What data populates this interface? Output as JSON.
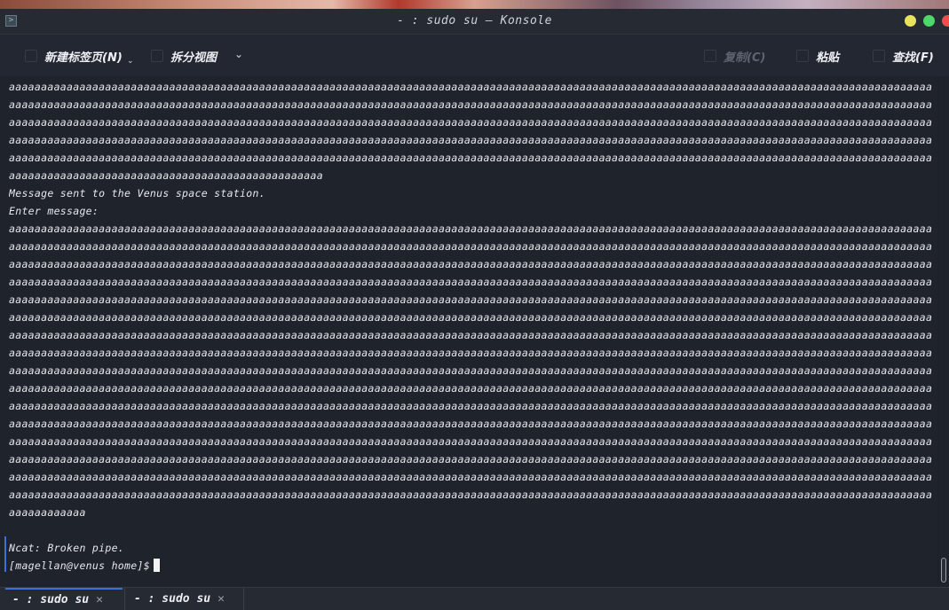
{
  "window": {
    "title": "- : sudo su — Konsole",
    "app_icon": "terminal-app-icon"
  },
  "toolbar": {
    "new_tab_label": "新建标签页(N)",
    "split_view_label": "拆分视图",
    "copy_label": "复制(C)",
    "paste_label": "粘贴",
    "find_label": "查找(F)"
  },
  "terminal": {
    "lines": [
      "aaaaaaaaaaaaaaaaaaaaaaaaaaaaaaaaaaaaaaaaaaaaaaaaaaaaaaaaaaaaaaaaaaaaaaaaaaaaaaaaaaaaaaaaaaaaaaaaaaaaaaaaaaaaaaaaaaaaaaaaaaaaaaaaaaaaaaaaaaaaaaaaa",
      "aaaaaaaaaaaaaaaaaaaaaaaaaaaaaaaaaaaaaaaaaaaaaaaaaaaaaaaaaaaaaaaaaaaaaaaaaaaaaaaaaaaaaaaaaaaaaaaaaaaaaaaaaaaaaaaaaaaaaaaaaaaaaaaaaaaaaaaaaaaaaaaaa",
      "aaaaaaaaaaaaaaaaaaaaaaaaaaaaaaaaaaaaaaaaaaaaaaaaaaaaaaaaaaaaaaaaaaaaaaaaaaaaaaaaaaaaaaaaaaaaaaaaaaaaaaaaaaaaaaaaaaaaaaaaaaaaaaaaaaaaaaaaaaaaaaaaa",
      "aaaaaaaaaaaaaaaaaaaaaaaaaaaaaaaaaaaaaaaaaaaaaaaaaaaaaaaaaaaaaaaaaaaaaaaaaaaaaaaaaaaaaaaaaaaaaaaaaaaaaaaaaaaaaaaaaaaaaaaaaaaaaaaaaaaaaaaaaaaaaaaaa",
      "aaaaaaaaaaaaaaaaaaaaaaaaaaaaaaaaaaaaaaaaaaaaaaaaaaaaaaaaaaaaaaaaaaaaaaaaaaaaaaaaaaaaaaaaaaaaaaaaaaaaaaaaaaaaaaaaaaaaaaaaaaaaaaaaaaaaaaaaaaaaaaaaa",
      "aaaaaaaaaaaaaaaaaaaaaaaaaaaaaaaaaaaaaaaaaaaaaaaaa",
      "Message sent to the Venus space station.",
      "Enter message:",
      "aaaaaaaaaaaaaaaaaaaaaaaaaaaaaaaaaaaaaaaaaaaaaaaaaaaaaaaaaaaaaaaaaaaaaaaaaaaaaaaaaaaaaaaaaaaaaaaaaaaaaaaaaaaaaaaaaaaaaaaaaaaaaaaaaaaaaaaaaaaaaaaaa",
      "aaaaaaaaaaaaaaaaaaaaaaaaaaaaaaaaaaaaaaaaaaaaaaaaaaaaaaaaaaaaaaaaaaaaaaaaaaaaaaaaaaaaaaaaaaaaaaaaaaaaaaaaaaaaaaaaaaaaaaaaaaaaaaaaaaaaaaaaaaaaaaaaa",
      "aaaaaaaaaaaaaaaaaaaaaaaaaaaaaaaaaaaaaaaaaaaaaaaaaaaaaaaaaaaaaaaaaaaaaaaaaaaaaaaaaaaaaaaaaaaaaaaaaaaaaaaaaaaaaaaaaaaaaaaaaaaaaaaaaaaaaaaaaaaaaaaaa",
      "aaaaaaaaaaaaaaaaaaaaaaaaaaaaaaaaaaaaaaaaaaaaaaaaaaaaaaaaaaaaaaaaaaaaaaaaaaaaaaaaaaaaaaaaaaaaaaaaaaaaaaaaaaaaaaaaaaaaaaaaaaaaaaaaaaaaaaaaaaaaaaaaa",
      "aaaaaaaaaaaaaaaaaaaaaaaaaaaaaaaaaaaaaaaaaaaaaaaaaaaaaaaaaaaaaaaaaaaaaaaaaaaaaaaaaaaaaaaaaaaaaaaaaaaaaaaaaaaaaaaaaaaaaaaaaaaaaaaaaaaaaaaaaaaaaaaaa",
      "aaaaaaaaaaaaaaaaaaaaaaaaaaaaaaaaaaaaaaaaaaaaaaaaaaaaaaaaaaaaaaaaaaaaaaaaaaaaaaaaaaaaaaaaaaaaaaaaaaaaaaaaaaaaaaaaaaaaaaaaaaaaaaaaaaaaaaaaaaaaaaaaa",
      "aaaaaaaaaaaaaaaaaaaaaaaaaaaaaaaaaaaaaaaaaaaaaaaaaaaaaaaaaaaaaaaaaaaaaaaaaaaaaaaaaaaaaaaaaaaaaaaaaaaaaaaaaaaaaaaaaaaaaaaaaaaaaaaaaaaaaaaaaaaaaaaaa",
      "aaaaaaaaaaaaaaaaaaaaaaaaaaaaaaaaaaaaaaaaaaaaaaaaaaaaaaaaaaaaaaaaaaaaaaaaaaaaaaaaaaaaaaaaaaaaaaaaaaaaaaaaaaaaaaaaaaaaaaaaaaaaaaaaaaaaaaaaaaaaaaaaa",
      "aaaaaaaaaaaaaaaaaaaaaaaaaaaaaaaaaaaaaaaaaaaaaaaaaaaaaaaaaaaaaaaaaaaaaaaaaaaaaaaaaaaaaaaaaaaaaaaaaaaaaaaaaaaaaaaaaaaaaaaaaaaaaaaaaaaaaaaaaaaaaaaaa",
      "aaaaaaaaaaaaaaaaaaaaaaaaaaaaaaaaaaaaaaaaaaaaaaaaaaaaaaaaaaaaaaaaaaaaaaaaaaaaaaaaaaaaaaaaaaaaaaaaaaaaaaaaaaaaaaaaaaaaaaaaaaaaaaaaaaaaaaaaaaaaaaaaa",
      "aaaaaaaaaaaaaaaaaaaaaaaaaaaaaaaaaaaaaaaaaaaaaaaaaaaaaaaaaaaaaaaaaaaaaaaaaaaaaaaaaaaaaaaaaaaaaaaaaaaaaaaaaaaaaaaaaaaaaaaaaaaaaaaaaaaaaaaaaaaaaaaaa",
      "aaaaaaaaaaaaaaaaaaaaaaaaaaaaaaaaaaaaaaaaaaaaaaaaaaaaaaaaaaaaaaaaaaaaaaaaaaaaaaaaaaaaaaaaaaaaaaaaaaaaaaaaaaaaaaaaaaaaaaaaaaaaaaaaaaaaaaaaaaaaaaaaa",
      "aaaaaaaaaaaaaaaaaaaaaaaaaaaaaaaaaaaaaaaaaaaaaaaaaaaaaaaaaaaaaaaaaaaaaaaaaaaaaaaaaaaaaaaaaaaaaaaaaaaaaaaaaaaaaaaaaaaaaaaaaaaaaaaaaaaaaaaaaaaaaaaaa",
      "aaaaaaaaaaaaaaaaaaaaaaaaaaaaaaaaaaaaaaaaaaaaaaaaaaaaaaaaaaaaaaaaaaaaaaaaaaaaaaaaaaaaaaaaaaaaaaaaaaaaaaaaaaaaaaaaaaaaaaaaaaaaaaaaaaaaaaaaaaaaaaaaa",
      "aaaaaaaaaaaaaaaaaaaaaaaaaaaaaaaaaaaaaaaaaaaaaaaaaaaaaaaaaaaaaaaaaaaaaaaaaaaaaaaaaaaaaaaaaaaaaaaaaaaaaaaaaaaaaaaaaaaaaaaaaaaaaaaaaaaaaaaaaaaaaaaaa",
      "aaaaaaaaaaaaaaaaaaaaaaaaaaaaaaaaaaaaaaaaaaaaaaaaaaaaaaaaaaaaaaaaaaaaaaaaaaaaaaaaaaaaaaaaaaaaaaaaaaaaaaaaaaaaaaaaaaaaaaaaaaaaaaaaaaaaaaaaaaaaaaaaa",
      "aaaaaaaaaaaa",
      "",
      "Ncat: Broken pipe.",
      "[magellan@venus home]$"
    ]
  },
  "tabs": [
    {
      "label": "- : sudo su",
      "active": true
    },
    {
      "label": "- : sudo su",
      "active": false
    }
  ],
  "colors": {
    "background": "#1f232b",
    "accent": "#3f6fd8",
    "text": "#e6e8ec",
    "minimize": "#e8e35a",
    "maximize": "#4fd86a",
    "close": "#f04e4e"
  }
}
